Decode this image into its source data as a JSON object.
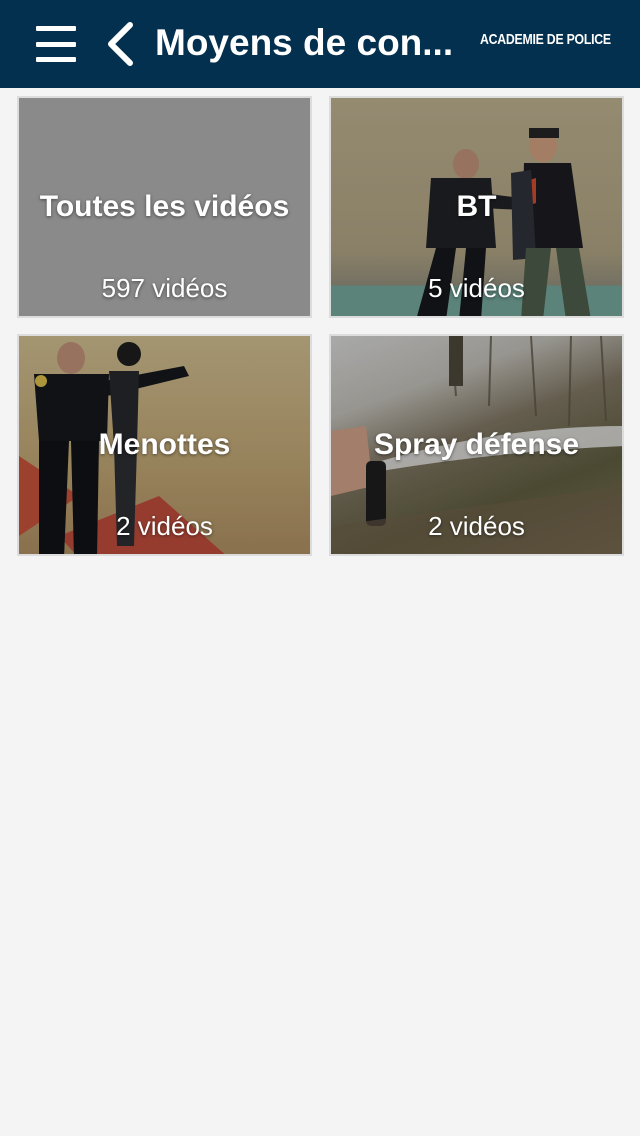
{
  "header": {
    "title": "Moyens de con...",
    "logo_text": "ACADEMIE DE POLICE",
    "background_color": "#04304f",
    "menu_icon": "hamburger-menu-icon",
    "back_icon": "chevron-left-icon"
  },
  "tiles": [
    {
      "title": "Toutes les vidéos",
      "count": "597 vidéos"
    },
    {
      "title": "BT",
      "count": "5 vidéos"
    },
    {
      "title": "Menottes",
      "count": "2 vidéos"
    },
    {
      "title": "Spray défense",
      "count": "2 vidéos"
    }
  ]
}
